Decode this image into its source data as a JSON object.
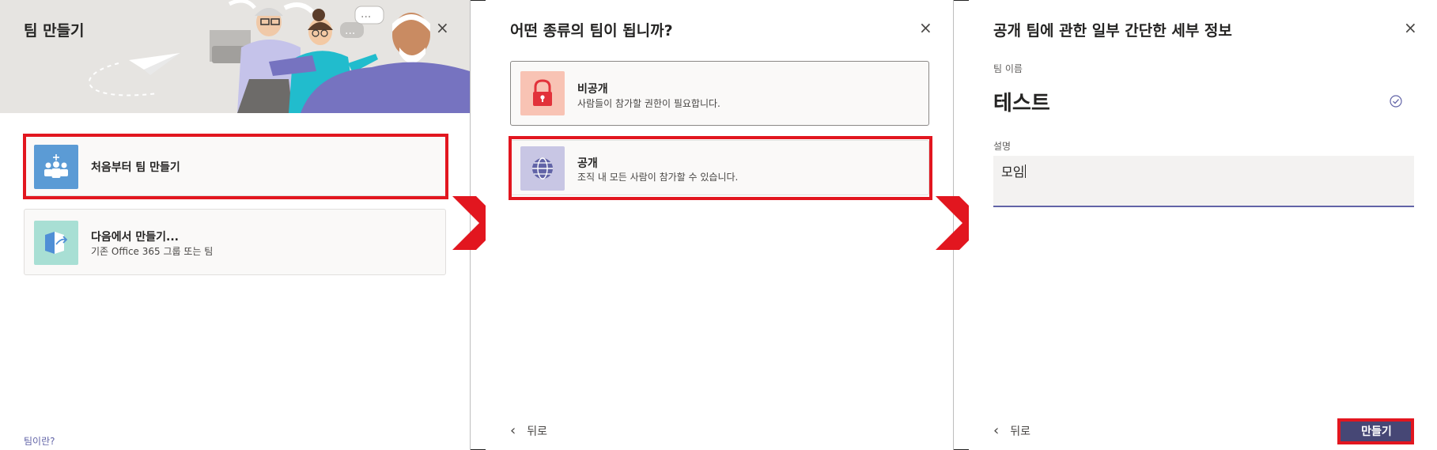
{
  "panel1": {
    "title": "팀 만들기",
    "close_glyph": "×",
    "option_scratch": {
      "label": "처음부터 팀 만들기"
    },
    "option_from": {
      "label": "다음에서 만들기...",
      "sub": "기존 Office 365 그룹 또는 팀"
    },
    "footer_link": "팀이란?"
  },
  "panel2": {
    "title": "어떤 종류의 팀이 됩니까?",
    "close_glyph": "×",
    "option_private": {
      "label": "비공개",
      "sub": "사람들이 참가할 권한이 필요합니다."
    },
    "option_public": {
      "label": "공개",
      "sub": "조직 내 모든 사람이 참가할 수 있습니다."
    },
    "back_label": "뒤로",
    "back_glyph": "‹"
  },
  "panel3": {
    "title": "공개 팀에 관한 일부 간단한 세부 정보",
    "close_glyph": "×",
    "name_label": "팀 이름",
    "name_value": "테스트",
    "desc_label": "설명",
    "desc_value": "모임",
    "back_label": "뒤로",
    "back_glyph": "‹",
    "create_label": "만들기"
  },
  "colors": {
    "accent": "#6264a7",
    "button": "#464775",
    "highlight": "#e2161f",
    "icon_scratch_bg": "#5b9bd5",
    "icon_from_bg": "#a8dfd4",
    "icon_private_bg": "#f8c3b4",
    "icon_public_bg": "#c8c6e4"
  },
  "icons": {
    "scratch": "team-people-icon",
    "from": "import-group-icon",
    "private": "lock-icon",
    "public": "globe-icon",
    "close": "close-icon",
    "back": "chevron-left-icon",
    "check": "check-circle-icon"
  }
}
